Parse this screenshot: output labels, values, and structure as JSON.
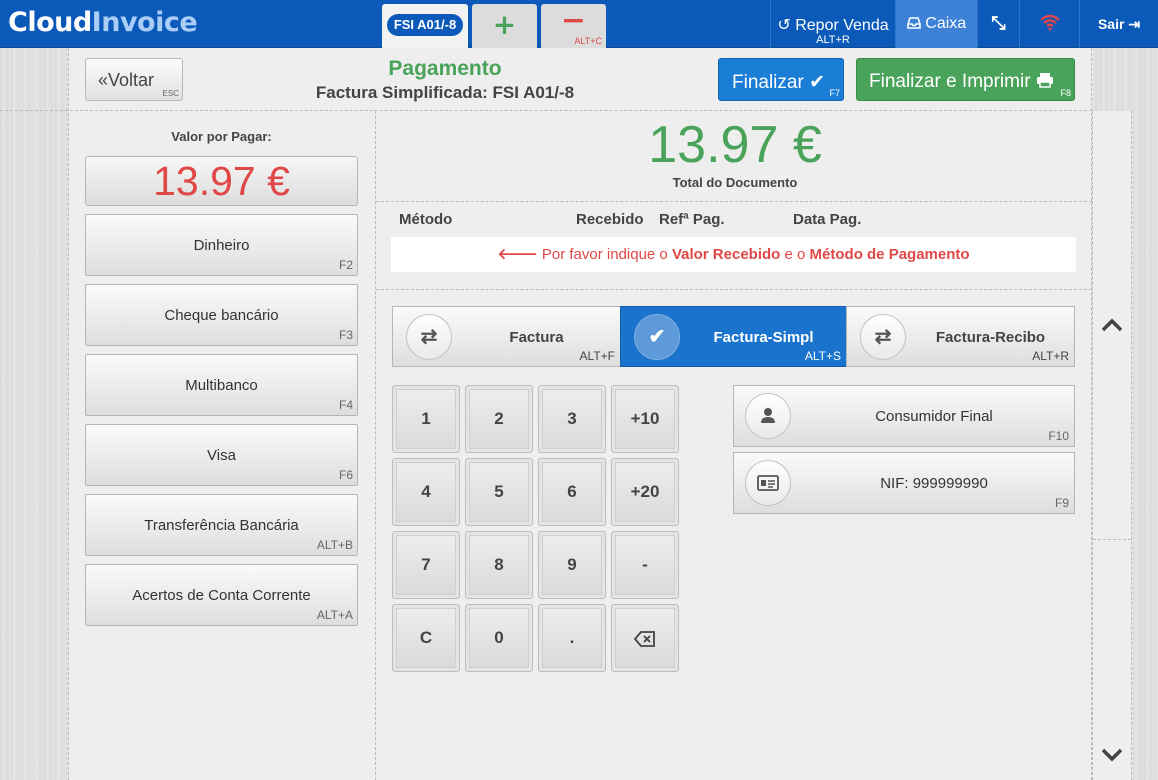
{
  "brand": {
    "part1": "Cloud",
    "part2": "Invoice"
  },
  "tabs": {
    "current_doc": "FSI A01/-8",
    "add_symbol": "+",
    "remove_symbol": "−",
    "remove_shortcut": "ALT+C"
  },
  "nav": {
    "repor_label": "Repor Venda",
    "repor_shortcut": "ALT+R",
    "caixa_label": "Caixa",
    "sair_label": "Sair"
  },
  "header": {
    "back_label": "Voltar",
    "back_shortcut": "ESC",
    "title": "Pagamento",
    "subtitle": "Factura Simplificada: FSI A01/-8",
    "finalize_label": "Finalizar",
    "finalize_shortcut": "F7",
    "finalize_print_label": "Finalizar e Imprimir",
    "finalize_print_shortcut": "F8"
  },
  "left": {
    "due_label": "Valor por Pagar:",
    "due_amount": "13.97 €",
    "methods": [
      {
        "label": "Dinheiro",
        "shortcut": "F2"
      },
      {
        "label": "Cheque bancário",
        "shortcut": "F3"
      },
      {
        "label": "Multibanco",
        "shortcut": "F4"
      },
      {
        "label": "Visa",
        "shortcut": "F6"
      },
      {
        "label": "Transferência Bancária",
        "shortcut": "ALT+B"
      },
      {
        "label": "Acertos de Conta Corrente",
        "shortcut": "ALT+A"
      }
    ]
  },
  "summary": {
    "total": "13.97 €",
    "total_label": "Total do Documento"
  },
  "payments_table": {
    "columns": [
      "Método",
      "Recebido",
      "Refª Pag.",
      "Data Pag."
    ],
    "message_pre": "Por favor indique o",
    "message_b1": "Valor Recebido",
    "message_mid": "e o",
    "message_b2": "Método de Pagamento"
  },
  "doc_types": [
    {
      "label": "Factura",
      "shortcut": "ALT+F",
      "active": false
    },
    {
      "label": "Factura-Simpl",
      "shortcut": "ALT+S",
      "active": true
    },
    {
      "label": "Factura-Recibo",
      "shortcut": "ALT+R",
      "active": false
    }
  ],
  "keypad": [
    "1",
    "2",
    "3",
    "+10",
    "4",
    "5",
    "6",
    "+20",
    "7",
    "8",
    "9",
    "-",
    "C",
    "0",
    "."
  ],
  "customer": {
    "name": "Consumidor Final",
    "name_shortcut": "F10",
    "nif": "NIF: 999999990",
    "nif_shortcut": "F9"
  },
  "colors": {
    "brand_blue": "#0b59b8",
    "green": "#4aa35a",
    "red": "#e04848",
    "active_blue": "#1a73cc"
  }
}
